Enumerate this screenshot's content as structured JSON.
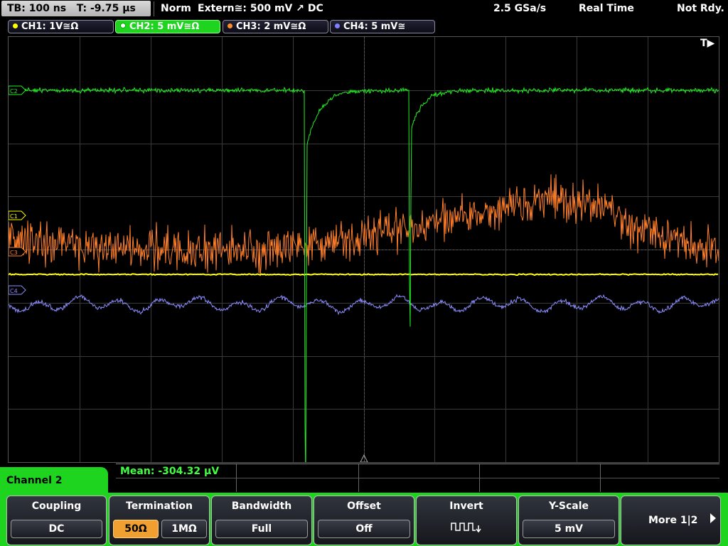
{
  "status": {
    "timebase": "TB: 100 ns",
    "trigger_time": "T: -9.75 µs",
    "mode": "Norm",
    "trigger_source": "Extern≅: 500 mV ↗ DC",
    "sample_rate": "2.5 GSa/s",
    "acq_mode": "Real Time",
    "state": "Not Rdy."
  },
  "channels": [
    {
      "label": "CH1: 1V≅Ω",
      "color": "#ffff00"
    },
    {
      "label": "CH2: 5 mV≅Ω",
      "color": "#33ff33"
    },
    {
      "label": "CH3: 2 mV≅Ω",
      "color": "#ff8c30"
    },
    {
      "label": "CH4: 5 mV≅",
      "color": "#8080ff"
    }
  ],
  "markers": {
    "ch1": "C1",
    "ch2": "C2",
    "ch3": "C3",
    "ch4": "C4",
    "trigger": "T▶"
  },
  "measurement": {
    "mean": "Mean: -304.32 µV"
  },
  "panel": {
    "title": "Channel 2",
    "coupling_title": "Coupling",
    "coupling_value": "DC",
    "termination_title": "Termination",
    "term_50": "50Ω",
    "term_1m": "1MΩ",
    "bandwidth_title": "Bandwidth",
    "bandwidth_value": "Full",
    "offset_title": "Offset",
    "offset_value": "Off",
    "invert_title": "Invert",
    "yscale_title": "Y-Scale",
    "yscale_value": "5 mV",
    "more_label": "More 1|2"
  },
  "colors": {
    "ch1": "#ffff00",
    "ch2": "#22ee22",
    "ch3": "#ff7f2a",
    "ch4": "#8c8cff",
    "accent": "#1fd41f"
  }
}
